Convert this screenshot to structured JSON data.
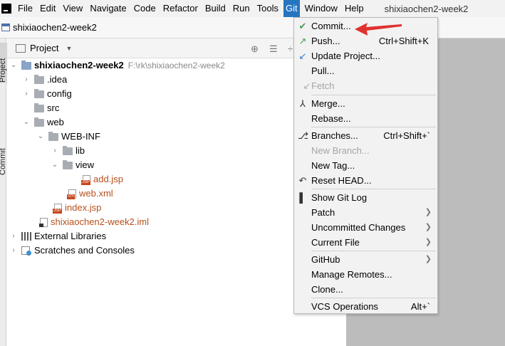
{
  "menubar": {
    "items": [
      "File",
      "Edit",
      "View",
      "Navigate",
      "Code",
      "Refactor",
      "Build",
      "Run",
      "Tools",
      "Git",
      "Window",
      "Help"
    ],
    "active": "Git",
    "title": "shixiaochen2-week2"
  },
  "breadcrumb": {
    "project": "shixiaochen2-week2"
  },
  "toolstrip": {
    "project_tab": "Project",
    "commit_tab": "Commit"
  },
  "panel": {
    "view_label": "Project",
    "buttons": [
      "crosshair-icon",
      "collapse-icon",
      "settings-icon"
    ]
  },
  "tree": {
    "root": {
      "name": "shixiaochen2-week2",
      "path": "F:\\rk\\shixiaochen2-week2"
    },
    "items": [
      {
        "label": ".idea"
      },
      {
        "label": "config"
      },
      {
        "label": "src"
      },
      {
        "label": "web"
      },
      {
        "label": "WEB-INF"
      },
      {
        "label": "lib"
      },
      {
        "label": "view"
      },
      {
        "label": "add.jsp"
      },
      {
        "label": "web.xml"
      },
      {
        "label": "index.jsp"
      },
      {
        "label": "shixiaochen2-week2.iml"
      },
      {
        "label": "External Libraries"
      },
      {
        "label": "Scratches and Consoles"
      }
    ]
  },
  "git_menu": {
    "items": [
      {
        "label": "Commit...",
        "icon": "check-icon",
        "shortcut": ""
      },
      {
        "label": "Push...",
        "icon": "push-arrow-icon",
        "shortcut": "Ctrl+Shift+K"
      },
      {
        "label": "Update Project...",
        "icon": "update-arrow-icon",
        "shortcut": ""
      },
      {
        "label": "Pull...",
        "icon": "",
        "shortcut": ""
      },
      {
        "label": "Fetch",
        "icon": "fetch-icon",
        "shortcut": "",
        "disabled": true
      },
      {
        "label": "Merge...",
        "icon": "merge-icon",
        "shortcut": ""
      },
      {
        "label": "Rebase...",
        "icon": "",
        "shortcut": ""
      },
      {
        "label": "Branches...",
        "icon": "branch-icon",
        "shortcut": "Ctrl+Shift+`"
      },
      {
        "label": "New Branch...",
        "icon": "",
        "shortcut": "",
        "disabled": true
      },
      {
        "label": "New Tag...",
        "icon": "",
        "shortcut": ""
      },
      {
        "label": "Reset HEAD...",
        "icon": "reset-icon",
        "shortcut": ""
      },
      {
        "label": "Show Git Log",
        "icon": "log-icon",
        "shortcut": ""
      },
      {
        "label": "Patch",
        "icon": "",
        "shortcut": "",
        "submenu": true
      },
      {
        "label": "Uncommitted Changes",
        "icon": "",
        "shortcut": "",
        "submenu": true
      },
      {
        "label": "Current File",
        "icon": "",
        "shortcut": "",
        "submenu": true
      },
      {
        "label": "GitHub",
        "icon": "",
        "shortcut": "",
        "submenu": true
      },
      {
        "label": "Manage Remotes...",
        "icon": "",
        "shortcut": ""
      },
      {
        "label": "Clone...",
        "icon": "",
        "shortcut": ""
      },
      {
        "label": "VCS Operations",
        "icon": "",
        "shortcut": "Alt+`"
      }
    ]
  },
  "colors": {
    "accent": "#2675bf",
    "file_orange": "#b74f1b",
    "annotation_red": "#e0312e"
  }
}
